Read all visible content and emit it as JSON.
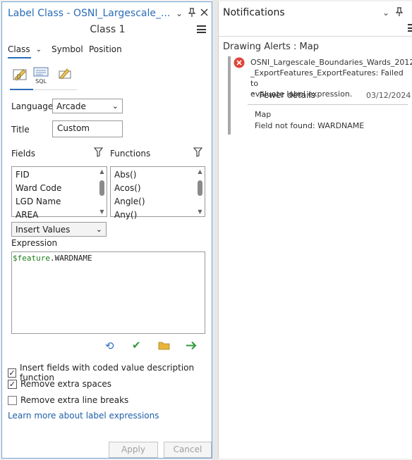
{
  "label_pane": {
    "title": "Label Class - OSNI_Largescale_...",
    "class_name": "Class 1",
    "tabs": {
      "class": "Class",
      "symbol": "Symbol",
      "position": "Position"
    },
    "sub_tabs": {
      "sql": "SQL"
    },
    "language_label": "Language",
    "language_value": "Arcade",
    "title_label": "Title",
    "title_value": "Custom",
    "fields_label": "Fields",
    "functions_label": "Functions",
    "fields": [
      "FID",
      "Ward Code",
      "LGD Name",
      "AREA"
    ],
    "functions": [
      "Abs()",
      "Acos()",
      "Angle()",
      "Any()"
    ],
    "insert_values": "Insert Values",
    "expression_label": "Expression",
    "expression_keyword": "$feature",
    "expression_rest": ".WARDNAME",
    "options": [
      {
        "label": "Insert fields with coded value description function",
        "checked": true
      },
      {
        "label": "Remove extra spaces",
        "checked": true
      },
      {
        "label": "Remove extra line breaks",
        "checked": false
      }
    ],
    "learn_more": "Learn more about label expressions",
    "apply": "Apply",
    "cancel": "Cancel"
  },
  "notifications": {
    "title": "Notifications",
    "group_title": "Drawing Alerts : Map",
    "alert_message": [
      "OSNI_Largescale_Boundaries_Wards_2012",
      "_ExportFeatures_ExportFeatures: Failed to",
      "evaluate label expression."
    ],
    "fewer_details": "Fewer details",
    "date": "03/12/2024",
    "detail_lines": [
      "Map",
      "Field not found: WARDNAME"
    ]
  },
  "colors": {
    "accent": "#2b6cb8",
    "error": "#e0443a",
    "link": "#1f5fa8",
    "arcade_keyword": "#1a7f1a"
  }
}
